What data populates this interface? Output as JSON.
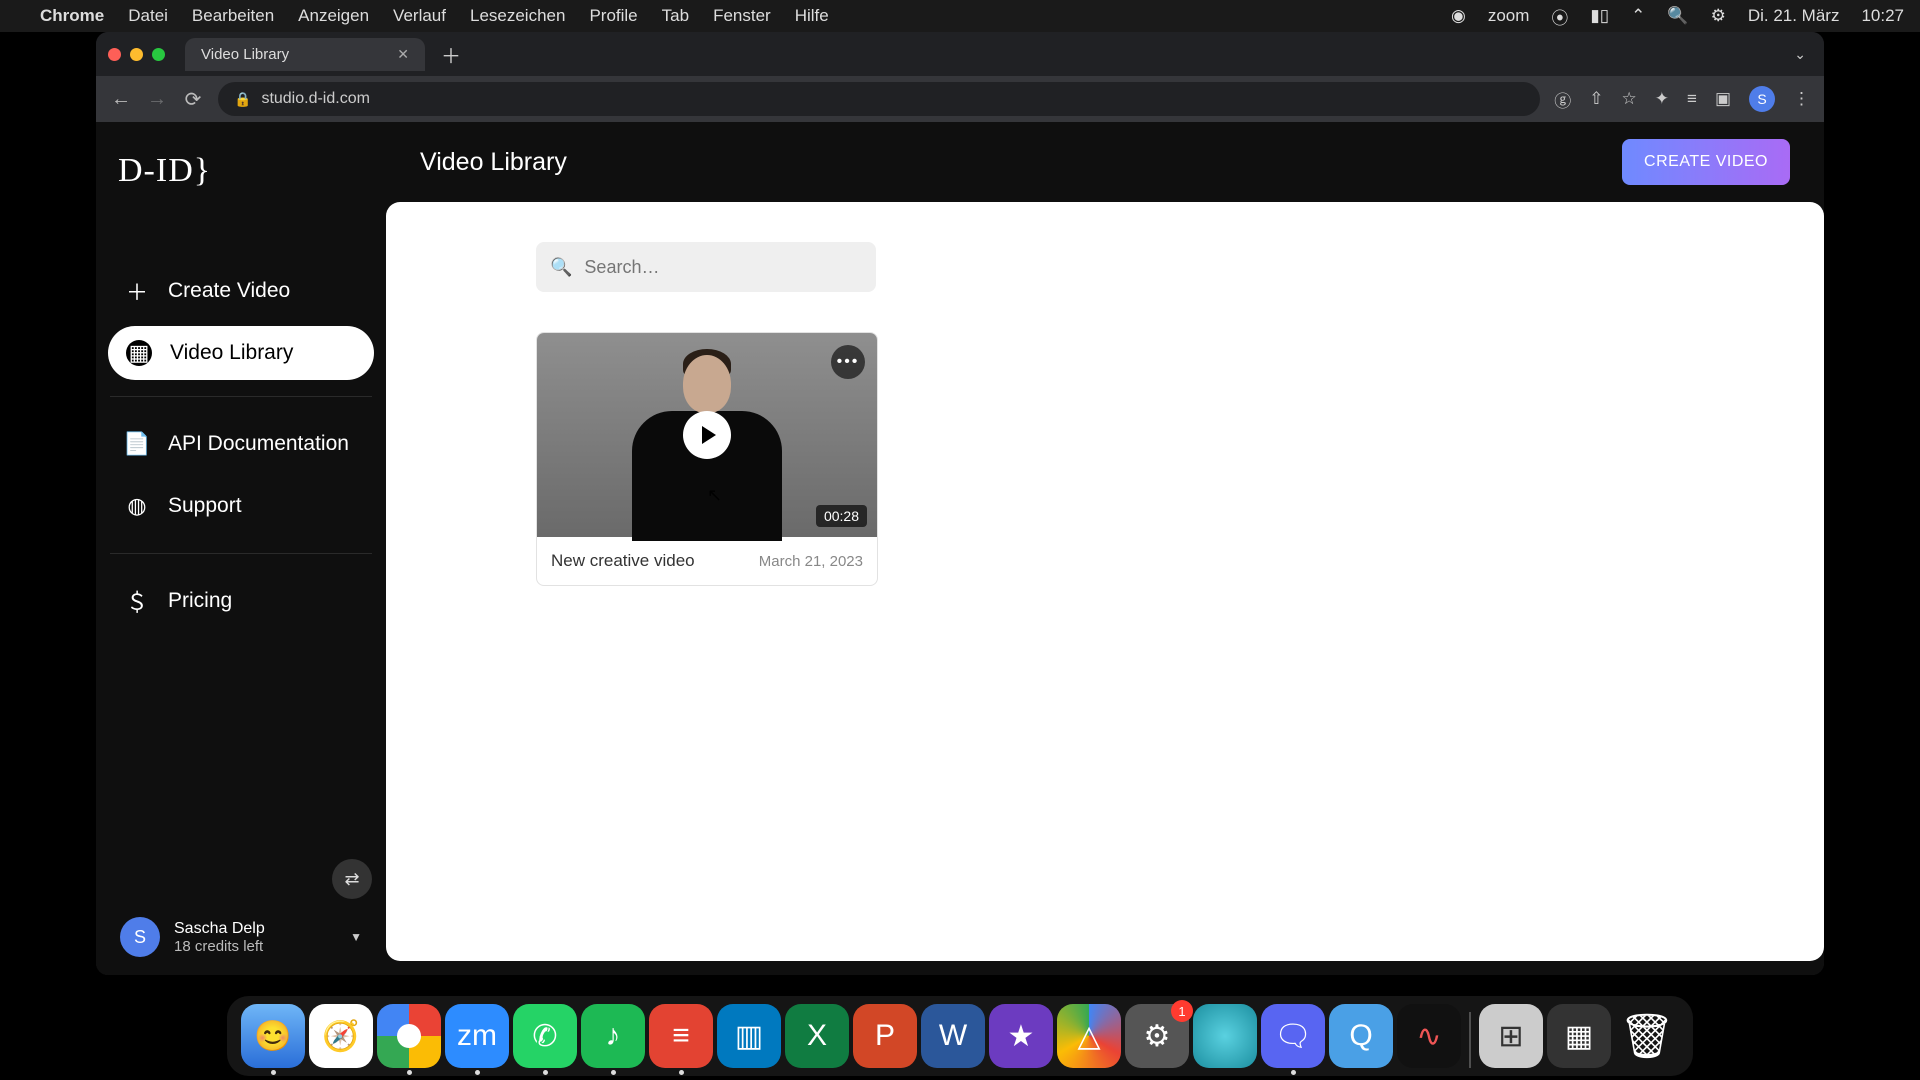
{
  "menubar": {
    "app": "Chrome",
    "items": [
      "Datei",
      "Bearbeiten",
      "Anzeigen",
      "Verlauf",
      "Lesezeichen",
      "Profile",
      "Tab",
      "Fenster",
      "Hilfe"
    ],
    "right": {
      "zoom": "zoom",
      "date": "Di. 21. März",
      "time": "10:27"
    }
  },
  "browser": {
    "tab_title": "Video Library",
    "url": "studio.d-id.com",
    "profile_initial": "S"
  },
  "app": {
    "logo": "D-ID}",
    "page_title": "Video Library",
    "create_button": "CREATE VIDEO",
    "search_placeholder": "Search…",
    "nav": {
      "create": "Create Video",
      "library": "Video Library",
      "api": "API Documentation",
      "support": "Support",
      "pricing": "Pricing"
    },
    "user": {
      "initial": "S",
      "name": "Sascha Delp",
      "credits": "18 credits left"
    },
    "videos": [
      {
        "title": "New creative video",
        "date": "March 21, 2023",
        "duration": "00:28"
      }
    ]
  },
  "dock": {
    "settings_badge": "1"
  }
}
